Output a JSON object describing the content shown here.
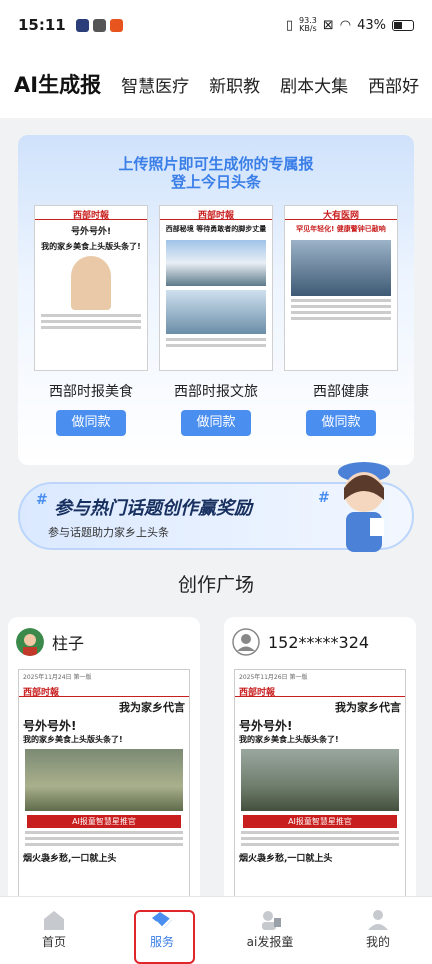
{
  "status": {
    "time": "15:11",
    "speed_top": "93.3",
    "speed_bottom": "KB/s",
    "battery": "43%"
  },
  "tabs": [
    "AI生成报",
    "智慧医疗",
    "新职教",
    "剧本大集",
    "西部好"
  ],
  "hero": {
    "title_line1": "上传照片即可生成你的专属报",
    "title_line2": "登上今日头条",
    "cards": [
      {
        "name": "西部时报美食",
        "button": "做同款",
        "headline": "号外号外!",
        "headline2": "我的家乡美食上头版头条了!",
        "masthead": "西部时報"
      },
      {
        "name": "西部时报文旅",
        "button": "做同款",
        "headline": "西部秘境 等待勇敢者的脚步丈量",
        "masthead": "西部时報"
      },
      {
        "name": "西部健康",
        "button": "做同款",
        "headline": "罕见年轻化! 健康警钟已敲响",
        "masthead": "大有医网"
      }
    ]
  },
  "banner": {
    "title": "参与热门话题创作赢奖励",
    "subtitle": "参与话题助力家乡上头条",
    "hash": "#"
  },
  "plaza": {
    "title": "创作广场"
  },
  "posts": [
    {
      "user": "柱子",
      "paper_masthead": "西部时報",
      "h1": "我为家乡代言",
      "h2": "号外号外!",
      "h3": "我的家乡美食上头版头条了!",
      "badge": "AI报童智慧星推官",
      "h4": "烟火袅乡愁,一口就上头",
      "date": "2025年11月24日 第一版"
    },
    {
      "user": "152*****324",
      "paper_masthead": "西部时報",
      "h1": "我为家乡代言",
      "h2": "号外号外!",
      "h3": "我的家乡美食上头版头条了!",
      "badge": "AI报童智慧星推官",
      "h4": "烟火袅乡愁,一口就上头",
      "date": "2025年11月26日 第一版"
    }
  ],
  "nav": [
    {
      "label": "首页",
      "icon": "home-icon"
    },
    {
      "label": "服务",
      "icon": "service-icon"
    },
    {
      "label": "ai发报童",
      "icon": "ai-reporter-icon"
    },
    {
      "label": "我的",
      "icon": "profile-icon"
    }
  ],
  "colors": {
    "accent": "#3a7ee8",
    "button": "#4a8ef0",
    "newspaper_red": "#c81e1e",
    "highlight": "#e0262a"
  }
}
